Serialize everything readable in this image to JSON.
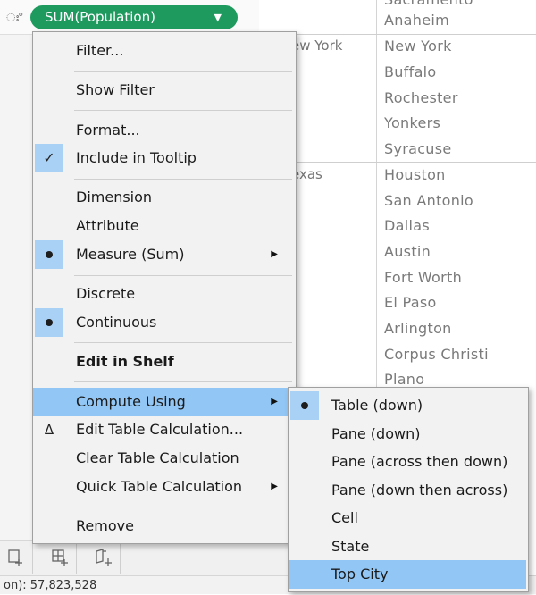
{
  "shelf": {
    "pill_label": "SUM(Population)",
    "pill_caret": "▼"
  },
  "table": {
    "partial_top": "Sacramento",
    "cities_ca": [
      "Anaheim"
    ],
    "state_ny": "ew York",
    "cities_ny": [
      "New York",
      "Buffalo",
      "Rochester",
      "Yonkers",
      "Syracuse"
    ],
    "state_tx": "exas",
    "cities_tx": [
      "Houston",
      "San Antonio",
      "Dallas",
      "Austin",
      "Fort Worth",
      "El Paso",
      "Arlington",
      "Corpus Christi",
      "Plano"
    ]
  },
  "status": {
    "text": "on): 57,823,528"
  },
  "context_menu": {
    "filter": "Filter...",
    "show_filter": "Show Filter",
    "format": "Format...",
    "include_tooltip": "Include in Tooltip",
    "dimension": "Dimension",
    "attribute": "Attribute",
    "measure": "Measure (Sum)",
    "discrete": "Discrete",
    "continuous": "Continuous",
    "edit_in_shelf": "Edit in Shelf",
    "compute_using": "Compute Using",
    "edit_table_calc": "Edit Table Calculation...",
    "clear_table_calc": "Clear Table Calculation",
    "quick_table_calc": "Quick Table Calculation",
    "remove": "Remove",
    "icons": {
      "check": "✓",
      "delta": "Δ",
      "submenu_arrow": "▶"
    }
  },
  "submenu": {
    "items": [
      "Table (down)",
      "Pane (down)",
      "Pane (across then down)",
      "Pane (down then across)",
      "Cell",
      "State",
      "Top City"
    ],
    "selected": "Table (down)",
    "hovered": "Top City"
  },
  "colors": {
    "pill": "#1f9a5f",
    "highlight": "#91c6f5",
    "selected_marker_bg": "#a9d0f5"
  }
}
